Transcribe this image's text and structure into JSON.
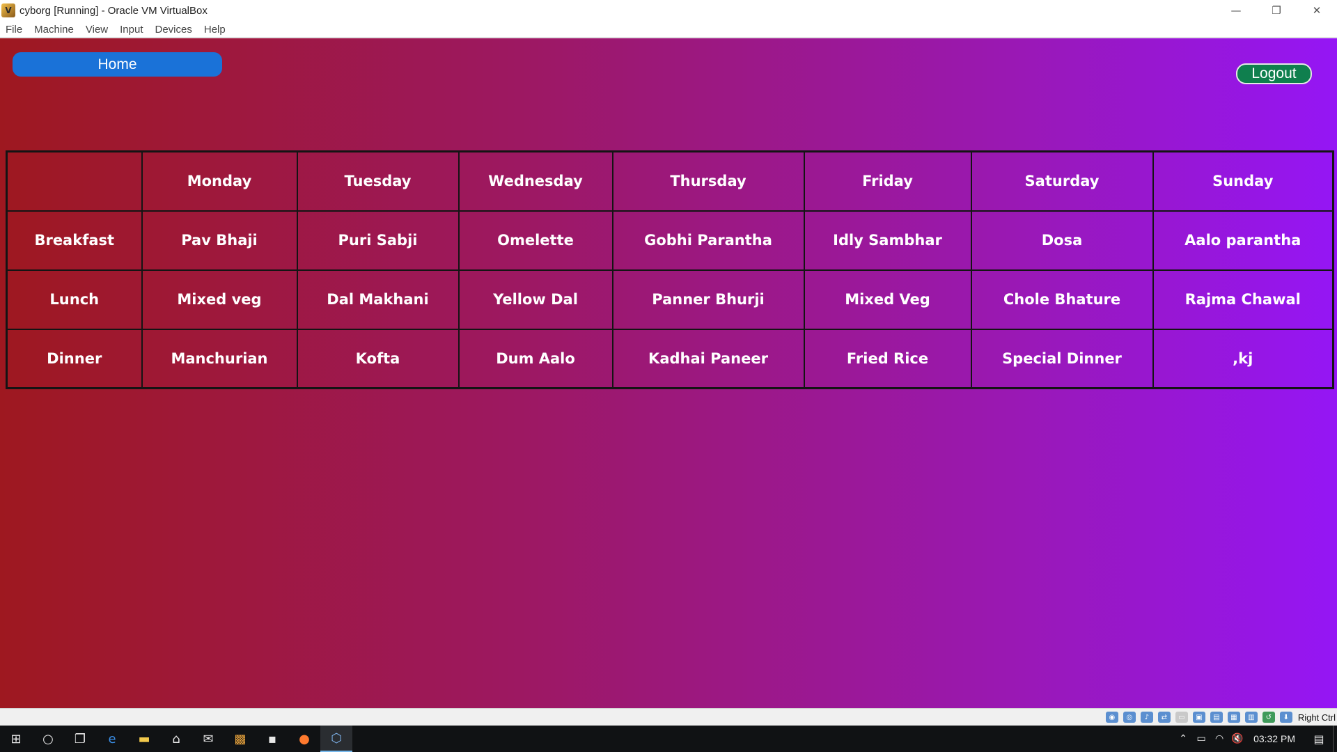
{
  "window": {
    "title": "cyborg [Running] - Oracle VM VirtualBox",
    "controls": [
      "—",
      "❐",
      "✕"
    ]
  },
  "menubar": {
    "items": [
      "File",
      "Machine",
      "View",
      "Input",
      "Devices",
      "Help"
    ]
  },
  "page": {
    "home_label": "Home",
    "logout_label": "Logout",
    "colors": {
      "home_button": "#1a72d8",
      "logout_button": "#0f7f4e",
      "gradient_start": "#9e1820",
      "gradient_end": "#9516f5"
    }
  },
  "menu_table": {
    "headers": [
      "",
      "Monday",
      "Tuesday",
      "Wednesday",
      "Thursday",
      "Friday",
      "Saturday",
      "Sunday"
    ],
    "rows": [
      [
        "Breakfast",
        "Pav Bhaji",
        "Puri Sabji",
        "Omelette",
        "Gobhi Parantha",
        "Idly Sambhar",
        "Dosa",
        "Aalo parantha"
      ],
      [
        "Lunch",
        "Mixed veg",
        "Dal Makhani",
        "Yellow Dal",
        "Panner Bhurji",
        "Mixed Veg",
        "Chole Bhature",
        "Rajma Chawal"
      ],
      [
        "Dinner",
        "Manchurian",
        "Kofta",
        "Dum Aalo",
        "Kadhai Paneer",
        "Fried Rice",
        "Special Dinner",
        ",kj"
      ]
    ]
  },
  "vbox_status": {
    "icons": [
      "hard-disk-icon",
      "optical-drive-icon",
      "audio-icon",
      "network-icon",
      "usb-icon",
      "shared-folders-icon",
      "display-icon",
      "video-capture-icon",
      "cpu-icon",
      "mouse-integration-icon",
      "keyboard-icon"
    ],
    "host_key": "Right Ctrl"
  },
  "taskbar": {
    "apps": [
      "start-icon",
      "cortana-icon",
      "task-view-icon",
      "edge-icon",
      "file-explorer-icon",
      "store-icon",
      "mail-icon",
      "office-icon",
      "app-icon",
      "firefox-icon",
      "virtualbox-icon"
    ],
    "clock": "03:32 PM"
  }
}
